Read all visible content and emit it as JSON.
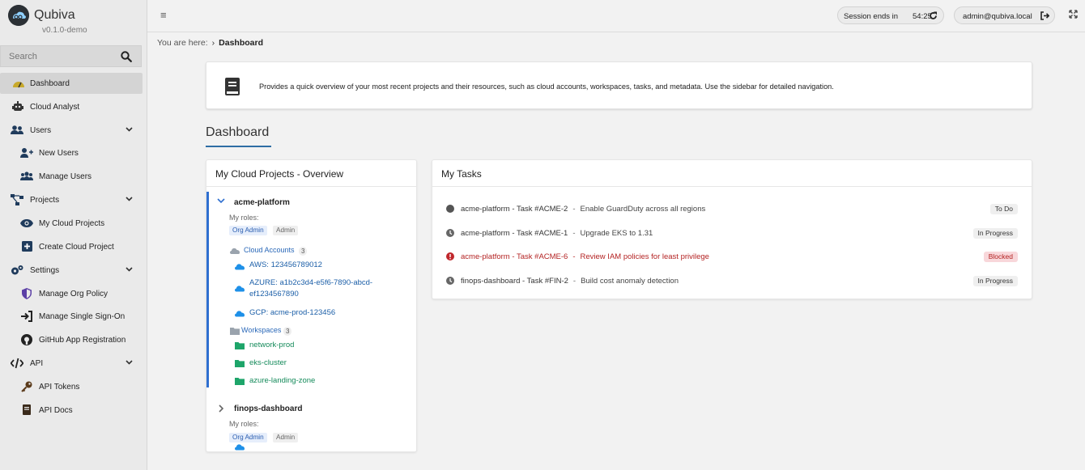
{
  "brand": {
    "name": "Qubiva",
    "version": "v0.1.0-demo"
  },
  "search": {
    "placeholder": "Search"
  },
  "sidebar": {
    "items": [
      {
        "label": "Dashboard"
      },
      {
        "label": "Cloud Analyst"
      },
      {
        "label": "Users"
      },
      {
        "label": "New Users"
      },
      {
        "label": "Manage Users"
      },
      {
        "label": "Projects"
      },
      {
        "label": "My Cloud Projects"
      },
      {
        "label": "Create Cloud Project"
      },
      {
        "label": "Settings"
      },
      {
        "label": "Manage Org Policy"
      },
      {
        "label": "Manage Single Sign-On"
      },
      {
        "label": "GitHub App Registration"
      },
      {
        "label": "API"
      },
      {
        "label": "API Tokens"
      },
      {
        "label": "API Docs"
      }
    ]
  },
  "topbar": {
    "menu_glyph": "≡",
    "session_label": "Session ends in",
    "session_time": "54:25",
    "user": "admin@qubiva.local"
  },
  "breadcrumb": {
    "prefix": "You are here:",
    "separator": "›",
    "current": "Dashboard"
  },
  "info": {
    "text": "Provides a quick overview of your most recent projects and their resources, such as cloud accounts, workspaces, tasks, and metadata. Use the sidebar for detailed navigation."
  },
  "page": {
    "title": "Dashboard"
  },
  "projects": {
    "title": "My Cloud Projects - Overview",
    "roles_label": "My roles:",
    "role_org": "Org Admin",
    "role_admin": "Admin",
    "p1": {
      "name": "acme-platform",
      "accounts_label": "Cloud Accounts",
      "accounts_count": "3",
      "accounts": [
        "AWS: 123456789012",
        "AZURE: a1b2c3d4-e5f6-7890-abcd-ef1234567890",
        "GCP: acme-prod-123456"
      ],
      "workspaces_label": "Workspaces",
      "workspaces_count": "3",
      "workspaces": [
        "network-prod",
        "eks-cluster",
        "azure-landing-zone"
      ]
    },
    "p2": {
      "name": "finops-dashboard"
    }
  },
  "tasks": {
    "title": "My Tasks",
    "items": [
      {
        "ref": "acme-platform - Task #ACME-2",
        "desc": "Enable GuardDuty across all regions",
        "status": "To Do"
      },
      {
        "ref": "acme-platform - Task #ACME-1",
        "desc": "Upgrade EKS to 1.31",
        "status": "In Progress"
      },
      {
        "ref": "acme-platform - Task #ACME-6",
        "desc": "Review IAM policies for least privilege",
        "status": "Blocked"
      },
      {
        "ref": "finops-dashboard - Task #FIN-2",
        "desc": "Build cost anomaly detection",
        "status": "In Progress"
      }
    ]
  },
  "colors": {
    "accent": "#2f6fd0",
    "blocked": "#b42323",
    "workspace": "#148a5a",
    "sidebar_bg": "#eaeaea"
  }
}
